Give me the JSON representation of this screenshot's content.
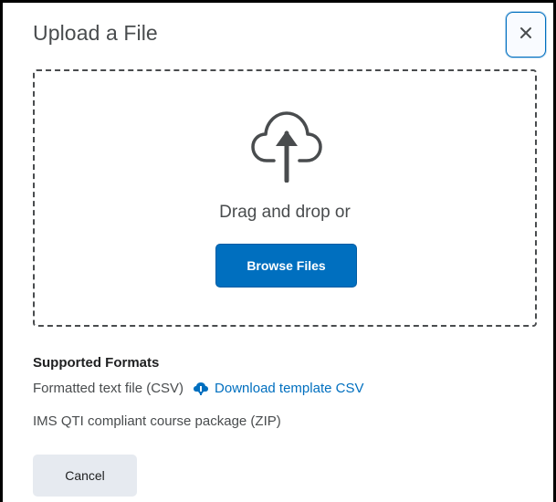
{
  "dialog": {
    "title": "Upload a File",
    "close_label": "×"
  },
  "dropzone": {
    "icon": "cloud-upload-icon",
    "instruction": "Drag and drop or",
    "browse_label": "Browse Files"
  },
  "formats": {
    "heading": "Supported Formats",
    "items": [
      {
        "label": "Formatted text file (CSV)",
        "link_label": "Download template CSV",
        "link_icon": "cloud-download-icon"
      },
      {
        "label": "IMS QTI compliant course package (ZIP)"
      }
    ]
  },
  "footer": {
    "cancel_label": "Cancel"
  },
  "colors": {
    "primary": "#006fbf",
    "text": "#494c4e",
    "secondary_button": "#e6eaf0"
  }
}
